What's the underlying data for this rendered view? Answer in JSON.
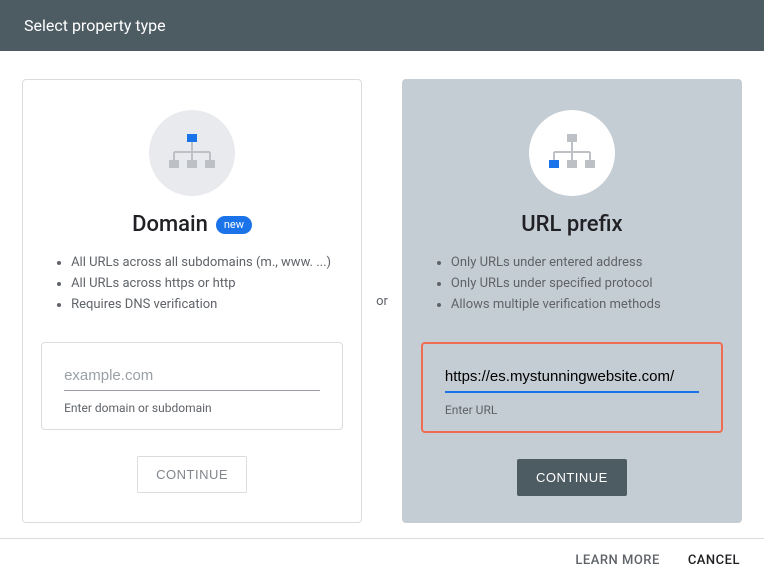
{
  "header": {
    "title": "Select property type"
  },
  "or_label": "or",
  "domain_card": {
    "title": "Domain",
    "badge": "new",
    "bullets": [
      "All URLs across all subdomains (m., www. ...)",
      "All URLs across https or http",
      "Requires DNS verification"
    ],
    "input_placeholder": "example.com",
    "input_value": "",
    "helper": "Enter domain or subdomain",
    "button": "CONTINUE"
  },
  "url_card": {
    "title": "URL prefix",
    "bullets": [
      "Only URLs under entered address",
      "Only URLs under specified protocol",
      "Allows multiple verification methods"
    ],
    "input_value": "https://es.mystunningwebsite.com/",
    "helper": "Enter URL",
    "button": "CONTINUE"
  },
  "footer": {
    "learn_more": "LEARN MORE",
    "cancel": "CANCEL"
  }
}
